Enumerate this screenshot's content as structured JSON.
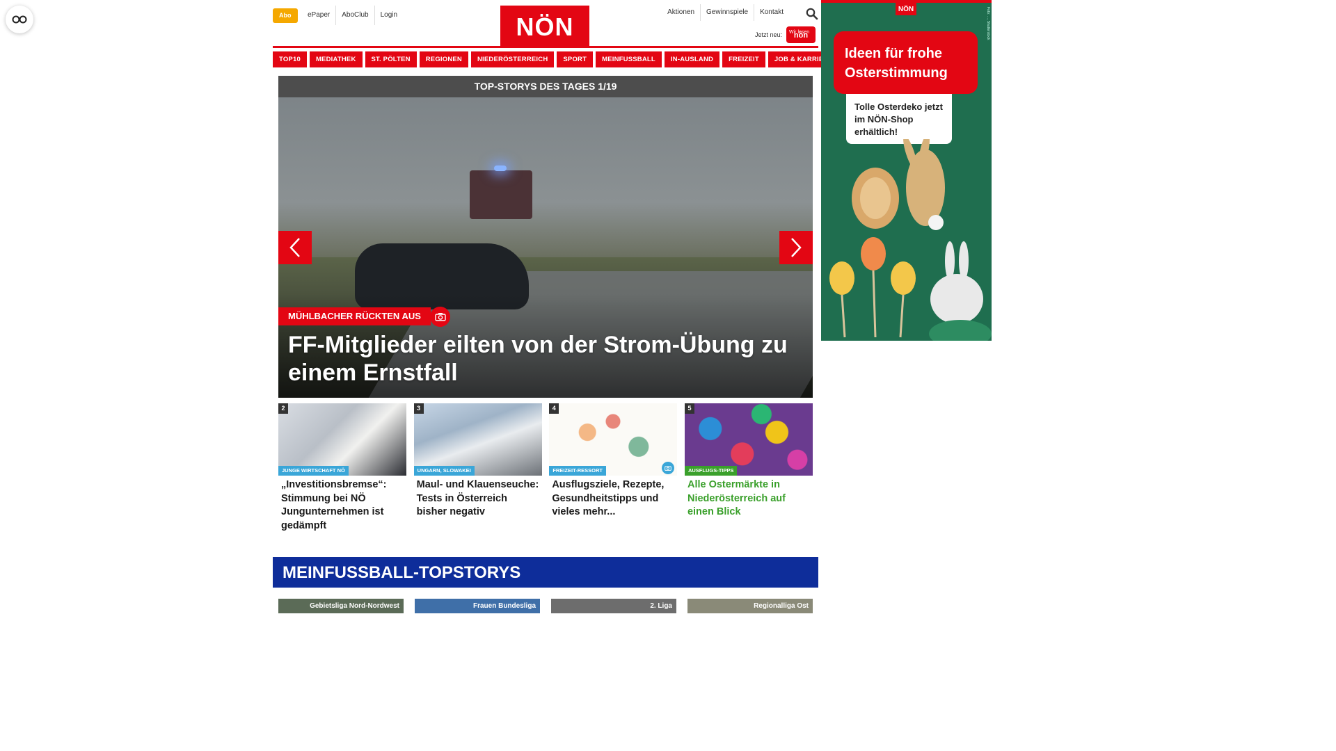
{
  "reader": {
    "icon": "glasses-icon"
  },
  "header": {
    "abo": "Abo",
    "links": [
      "ePaper",
      "AboClub",
      "Login"
    ],
    "logo": "NÖN",
    "right_links": [
      "Aktionen",
      "Gewinnspiele",
      "Kontakt"
    ],
    "jetzt_neu": "Jetzt neu:",
    "promo_small": "Wir lesen",
    "promo_logo": "nön"
  },
  "nav": [
    "TOP10",
    "MEDIATHEK",
    "ST. PÖLTEN",
    "REGIONEN",
    "NIEDERÖSTERREICH",
    "SPORT",
    "MEINFUSSBALL",
    "IN-AUSLAND",
    "FREIZEIT",
    "JOB & KARRIERE"
  ],
  "slider": {
    "heading": "TOP-STORYS DES TAGES 1/19",
    "kicker": "MÜHLBACHER RÜCKTEN AUS",
    "title": "FF-Mitglieder eilten von der Strom-Übung zu einem Ernstfall"
  },
  "cards": [
    {
      "num": "2",
      "tag": "JUNGE WIRTSCHAFT NÖ",
      "tag_color": "#3aa6d8",
      "title": "„Investitionsbremse“: Stimmung bei NÖ Jungunternehmen ist gedämpft"
    },
    {
      "num": "3",
      "tag": "UNGARN, SLOWAKEI",
      "tag_color": "#3aa6d8",
      "title": "Maul- und Klauenseuche: Tests in Österreich bisher negativ"
    },
    {
      "num": "4",
      "tag": "FREIZEIT-RESSORT",
      "tag_color": "#3aa6d8",
      "title": "Ausflugsziele, Rezepte, Gesundheitstipps und vieles mehr..."
    },
    {
      "num": "5",
      "tag": "AUSFLUGS-TIPPS",
      "tag_color": "#3aa02b",
      "title": "Alle Ostermärkte in Niederösterreich auf einen Blick"
    }
  ],
  "section": {
    "title": "MEINFUSSBALL-TOPSTORYS",
    "minis": [
      "Gebietsliga Nord-Nordwest",
      "Frauen Bundesliga",
      "2. Liga",
      "Regionalliga Ost"
    ]
  },
  "ad": {
    "logo": "NÖN",
    "headline": "Ideen für frohe Osterstimmung",
    "note": "Tolle Osterdeko jetzt im NÖN-Shop erhältlich!",
    "credit": "Foto: ..., Shutterstock"
  },
  "colors": {
    "brand_red": "#e30613",
    "abo_yellow": "#f5a800",
    "section_blue": "#0e2d9a",
    "ad_green": "#1f6e4f"
  }
}
